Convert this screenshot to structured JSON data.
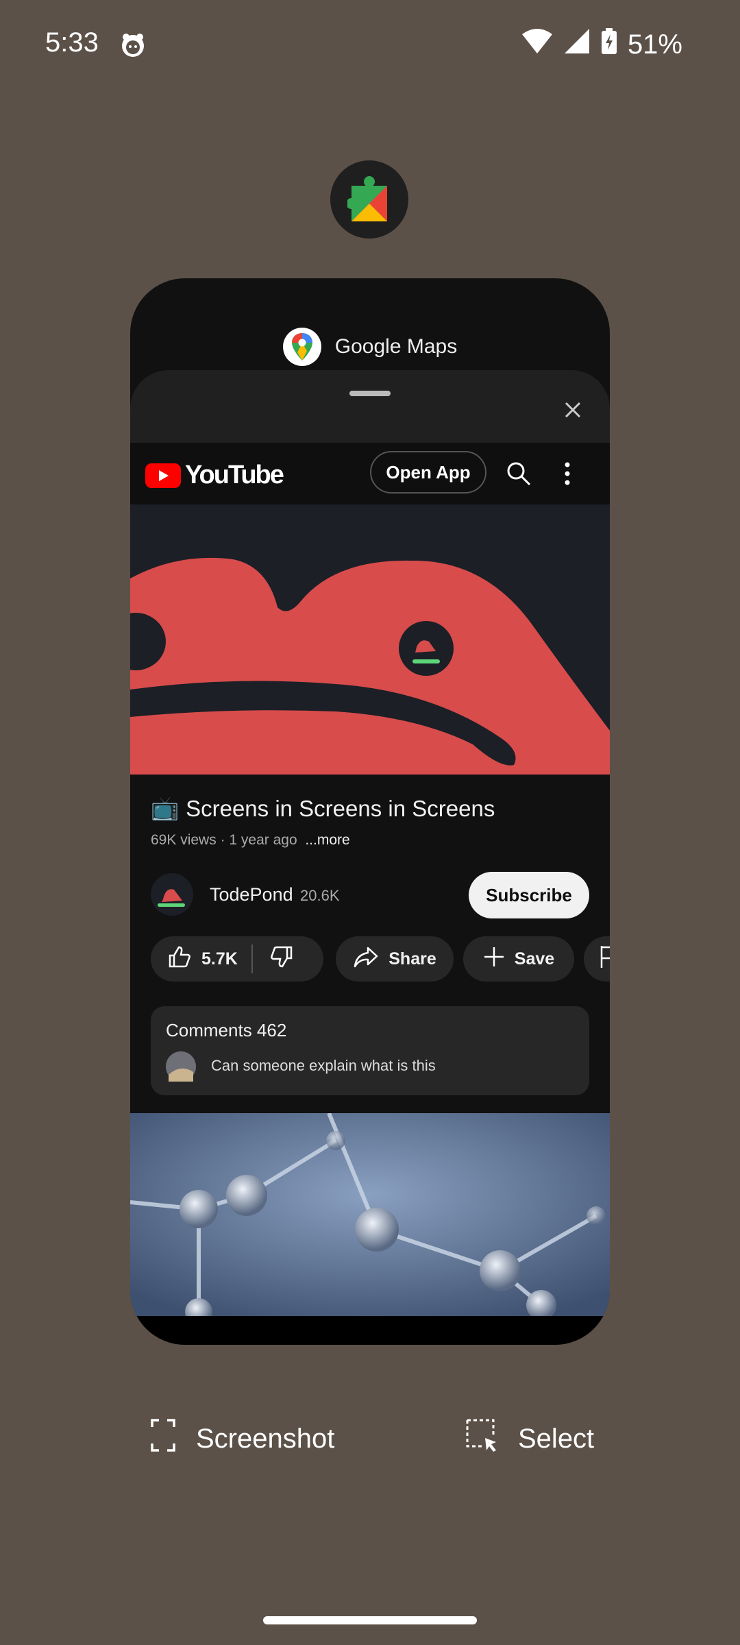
{
  "status_bar": {
    "time": "5:33",
    "battery": "51%"
  },
  "app_icon": {
    "icon": "google-play-services-icon"
  },
  "card": {
    "app_name": "Google Maps",
    "youtube": {
      "logo_text": "YouTube",
      "open_app_label": "Open App",
      "video": {
        "title": "Screens in Screens in Screens",
        "title_emoji": "📺",
        "views": "69K views",
        "age": "1 year ago",
        "separator": "·",
        "more_label": "...more"
      },
      "channel": {
        "name": "TodePond",
        "subscribers": "20.6K",
        "subscribe_label": "Subscribe"
      },
      "actions": {
        "likes": "5.7K",
        "share_label": "Share",
        "save_label": "Save"
      },
      "comments": {
        "title": "Comments 462",
        "first_comment": "Can someone explain what is this"
      }
    }
  },
  "bottom_actions": {
    "screenshot_label": "Screenshot",
    "select_label": "Select"
  },
  "colors": {
    "background": "#5c5148",
    "youtube_red": "#ff0000",
    "frog_red": "#d84c4c"
  }
}
